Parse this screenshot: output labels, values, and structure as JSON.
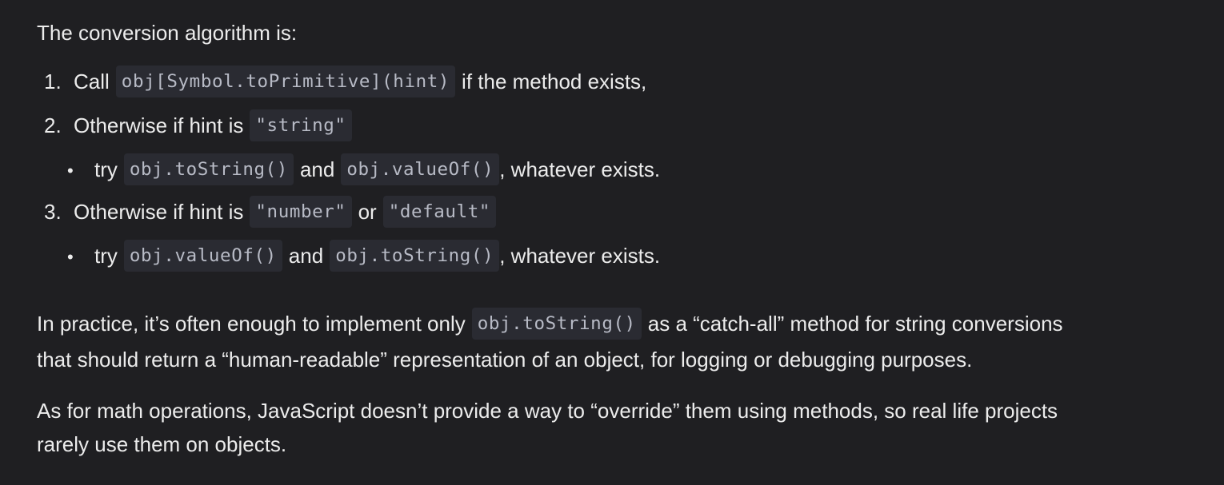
{
  "intro": "The conversion algorithm is:",
  "steps": [
    {
      "number": "1.",
      "before": "Call",
      "code": "obj[Symbol.toPrimitive](hint)",
      "after": "if the method exists,"
    },
    {
      "number": "2.",
      "before": "Otherwise if hint is",
      "code": "\"string\"",
      "sub": {
        "bullet": "•",
        "word": "try",
        "code1": "obj.toString()",
        "join": "and",
        "code2": "obj.valueOf()",
        "after": ", whatever exists."
      }
    },
    {
      "number": "3.",
      "before": "Otherwise if hint is",
      "code": "\"number\"",
      "join": "or",
      "code2": "\"default\"",
      "sub": {
        "bullet": "•",
        "word": "try",
        "code1": "obj.valueOf()",
        "join": "and",
        "code2": "obj.toString()",
        "after": ", whatever exists."
      }
    }
  ],
  "para1": {
    "before": "In practice, it’s often enough to implement only",
    "code": "obj.toString()",
    "after": "as a “catch-all” method for string conversions",
    "line2": "that should return a “human-readable” representation of an object, for logging or debugging purposes."
  },
  "para2": {
    "line1": "As for math operations, JavaScript doesn’t provide a way to “override” them using methods, so real life projects",
    "line2": "rarely use them on objects."
  }
}
